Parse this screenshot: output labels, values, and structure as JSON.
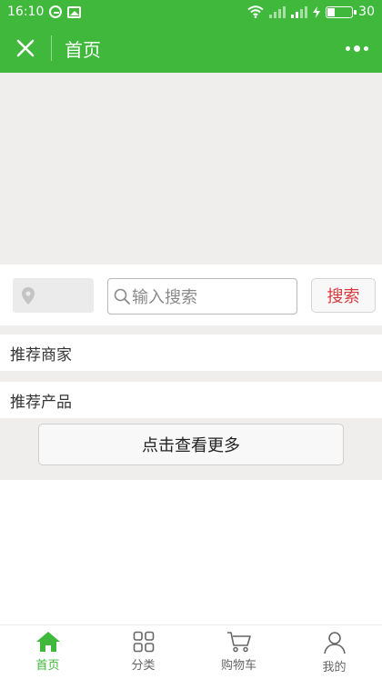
{
  "status_bar": {
    "time": "16:10",
    "battery": "30"
  },
  "title_bar": {
    "title": "首页"
  },
  "search": {
    "placeholder": "输入搜索",
    "button_label": "搜索"
  },
  "sections": {
    "recommended_merchants": "推荐商家",
    "recommended_products": "推荐产品",
    "view_more": "点击查看更多"
  },
  "tabbar": {
    "items": [
      {
        "label": "首页",
        "icon": "home-icon",
        "active": true
      },
      {
        "label": "分类",
        "icon": "grid-icon",
        "active": false
      },
      {
        "label": "购物车",
        "icon": "cart-icon",
        "active": false
      },
      {
        "label": "我的",
        "icon": "user-icon",
        "active": false
      }
    ]
  },
  "colors": {
    "brand": "#3fb83c",
    "search_button_text": "#d6393b",
    "background_gray": "#efeeec"
  }
}
